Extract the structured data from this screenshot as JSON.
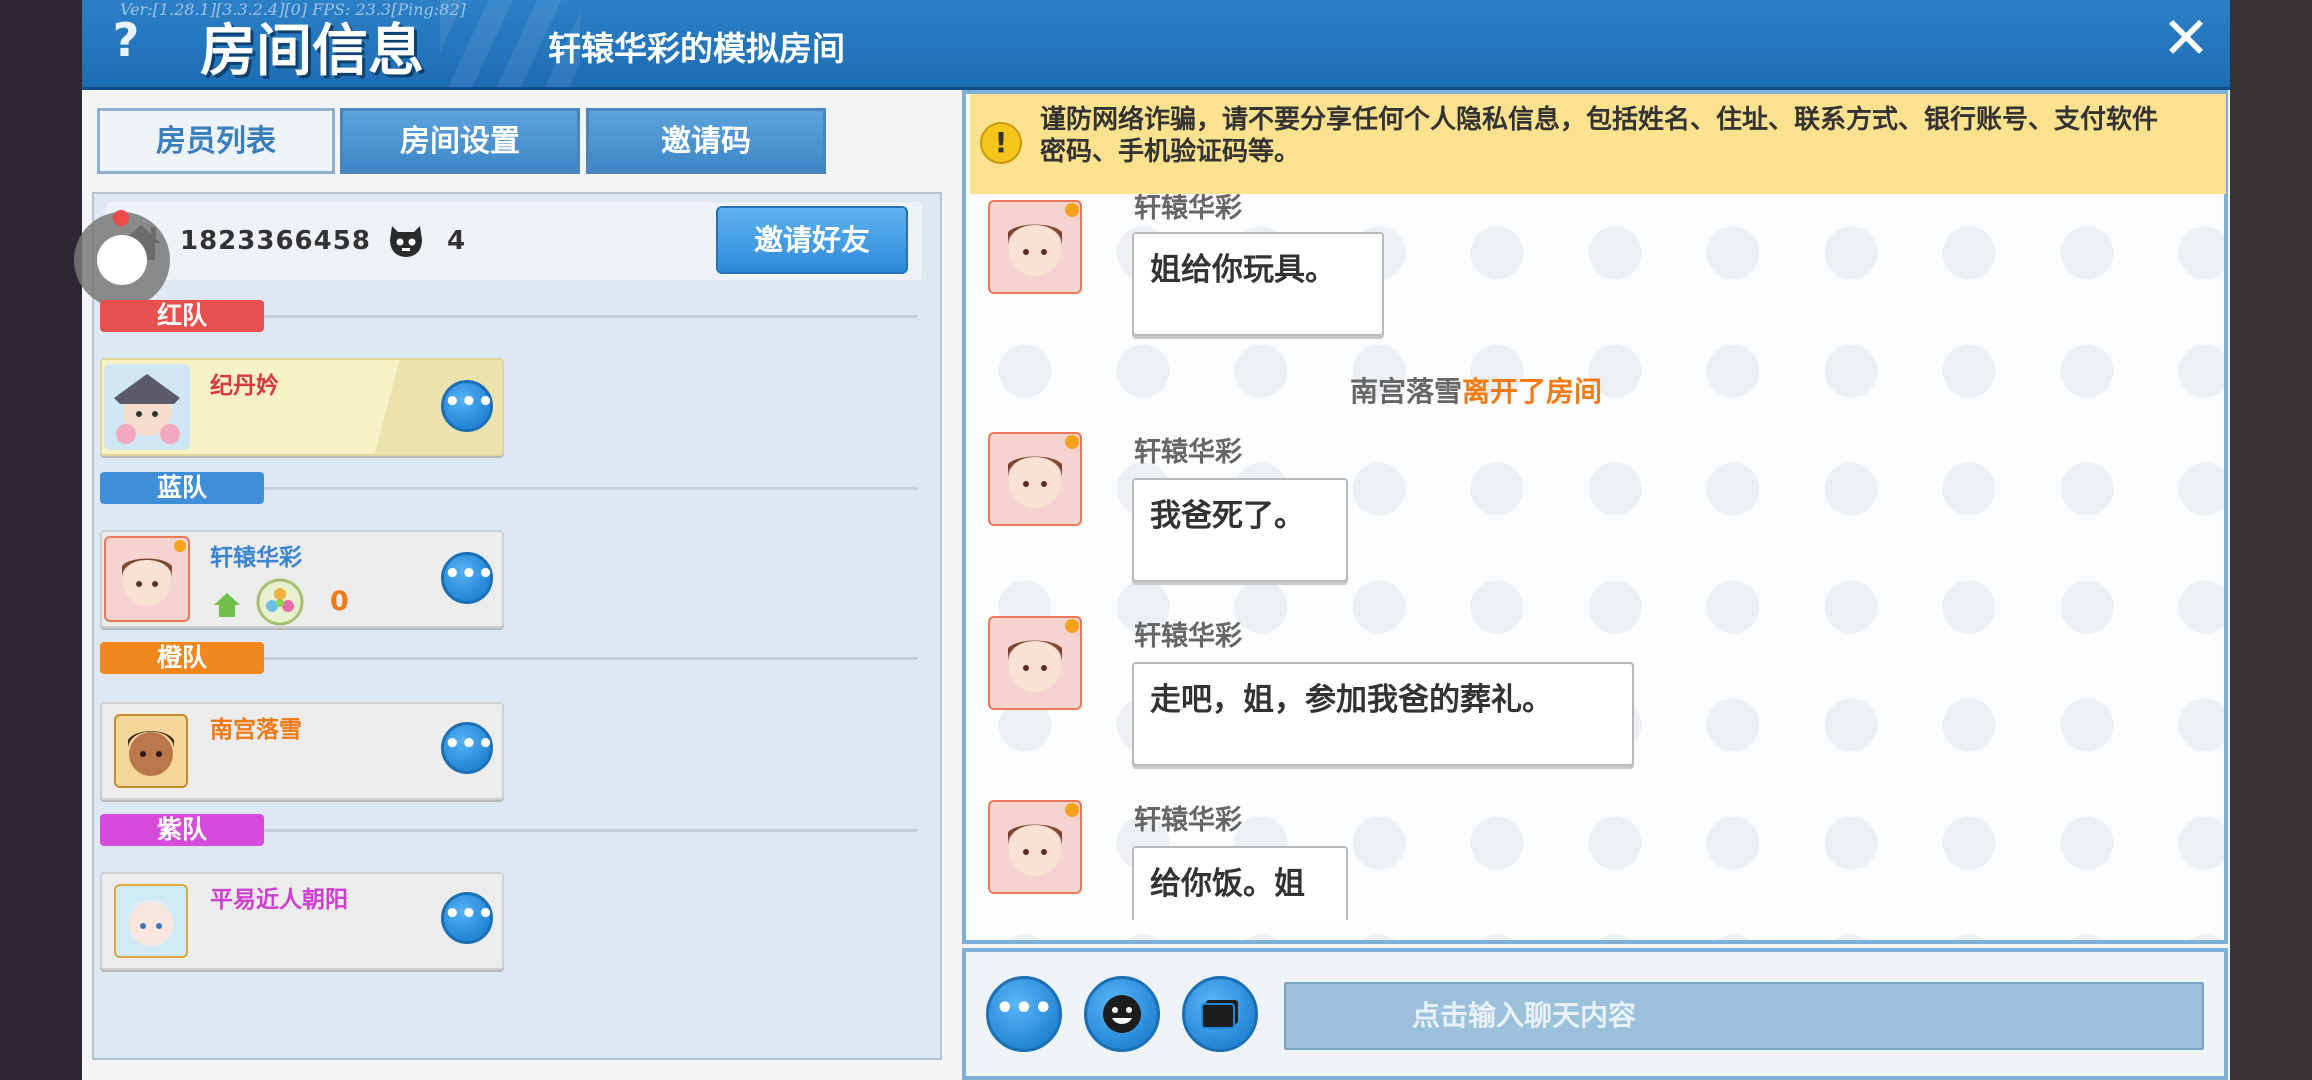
{
  "header": {
    "debug": "Ver:[1.28.1][3.3.2.4][0] FPS: 23.3[Ping:82]",
    "help_label": "?",
    "title": "房间信息",
    "room_name": "轩辕华彩的模拟房间",
    "close_label": "✕"
  },
  "tabs": [
    {
      "label": "房员列表",
      "active": true
    },
    {
      "label": "房间设置",
      "active": false
    },
    {
      "label": "邀请码",
      "active": false
    }
  ],
  "room_info": {
    "room_id": "1823366458",
    "player_count": "4",
    "invite_button": "邀请好友"
  },
  "teams": [
    {
      "label": "红队",
      "color": "#e84f4f",
      "players": [
        {
          "name": "纪丹妗",
          "name_color": "#d9393e"
        }
      ]
    },
    {
      "label": "蓝队",
      "color": "#3f8fd8",
      "players": [
        {
          "name": "轩辕华彩",
          "name_color": "#3a84d2",
          "score": "0"
        }
      ]
    },
    {
      "label": "橙队",
      "color": "#f0881e",
      "players": [
        {
          "name": "南宫落雪",
          "name_color": "#ef7a14"
        }
      ]
    },
    {
      "label": "紫队",
      "color": "#d64bdc",
      "players": [
        {
          "name": "平易近人朝阳",
          "name_color": "#cc3fcf"
        }
      ]
    }
  ],
  "warning": {
    "icon": "!",
    "text": "谨防网络诈骗，请不要分享任何个人隐私信息，包括姓名、住址、联系方式、银行账号、支付软件密码、手机验证码等。"
  },
  "messages": [
    {
      "sender": "轩辕华彩",
      "text": "姐给你玩具。"
    },
    {
      "system_name": "南宫落雪",
      "system_action": "离开了房间"
    },
    {
      "sender": "轩辕华彩",
      "text": "我爸死了。"
    },
    {
      "sender": "轩辕华彩",
      "text": "走吧，姐，参加我爸的葬礼。"
    },
    {
      "sender": "轩辕华彩",
      "text": "给你饭。姐"
    }
  ],
  "input": {
    "more_label": "•••",
    "placeholder": "点击输入聊天内容"
  },
  "colors": {
    "accent": "#2e8ad8",
    "warning_bg": "#fbe28f",
    "system_action": "#f07a14"
  }
}
